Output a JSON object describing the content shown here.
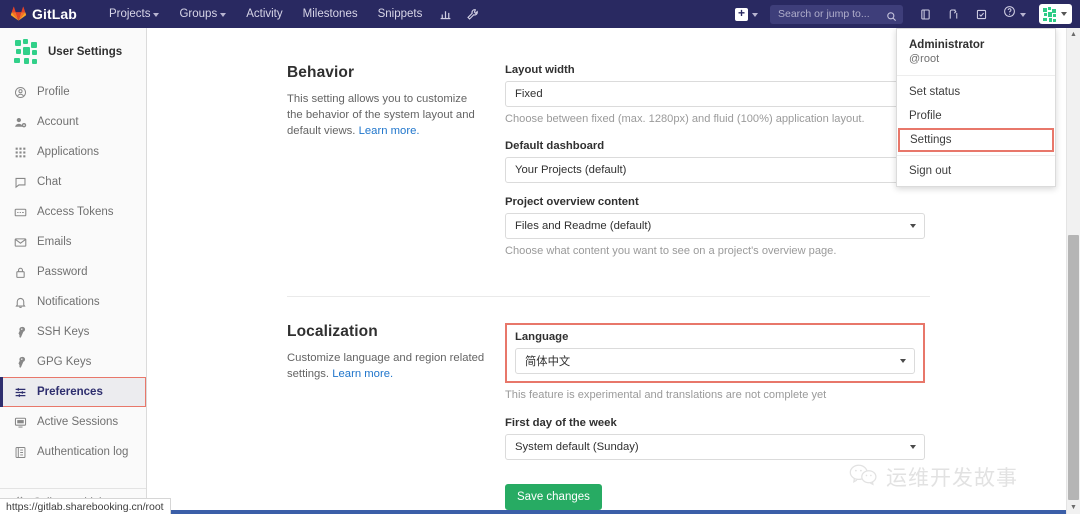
{
  "navbar": {
    "brand": "GitLab",
    "brand_icon": "gitlab-fox-logo",
    "links": [
      {
        "label": "Projects",
        "has_caret": true,
        "name": "nav-projects"
      },
      {
        "label": "Groups",
        "has_caret": true,
        "name": "nav-groups"
      },
      {
        "label": "Activity",
        "has_caret": false,
        "name": "nav-activity"
      },
      {
        "label": "Milestones",
        "has_caret": false,
        "name": "nav-milestones"
      },
      {
        "label": "Snippets",
        "has_caret": false,
        "name": "nav-snippets"
      }
    ],
    "icon_buttons": [
      {
        "name": "analytics-chart-icon"
      },
      {
        "name": "wrench-icon"
      }
    ],
    "plus_label": "+",
    "search": {
      "placeholder": "Search or jump to...",
      "value": "",
      "icon": "search-icon"
    },
    "right_icons": [
      {
        "name": "issues-icon"
      },
      {
        "name": "merge-requests-icon"
      },
      {
        "name": "todos-icon"
      }
    ],
    "help_icon": "help-question-icon",
    "avatar_icon": "user-identicon-avatar"
  },
  "user_dropdown": {
    "name": "Administrator",
    "handle": "@root",
    "items": [
      {
        "label": "Set status",
        "highlighted": false,
        "name": "dropdown-set-status"
      },
      {
        "label": "Profile",
        "highlighted": false,
        "name": "dropdown-profile"
      },
      {
        "label": "Settings",
        "highlighted": true,
        "name": "dropdown-settings"
      },
      {
        "label": "Sign out",
        "highlighted": false,
        "name": "dropdown-sign-out"
      }
    ]
  },
  "sidebar": {
    "title": "User Settings",
    "avatar_icon": "user-identicon-avatar",
    "items": [
      {
        "label": "Profile",
        "icon": "user-circle-icon",
        "active": false,
        "outlined": false
      },
      {
        "label": "Account",
        "icon": "account-gear-icon",
        "active": false,
        "outlined": false
      },
      {
        "label": "Applications",
        "icon": "grid-apps-icon",
        "active": false,
        "outlined": false
      },
      {
        "label": "Chat",
        "icon": "chat-bubble-icon",
        "active": false,
        "outlined": false
      },
      {
        "label": "Access Tokens",
        "icon": "token-card-icon",
        "active": false,
        "outlined": false
      },
      {
        "label": "Emails",
        "icon": "envelope-icon",
        "active": false,
        "outlined": false
      },
      {
        "label": "Password",
        "icon": "lock-icon",
        "active": false,
        "outlined": false
      },
      {
        "label": "Notifications",
        "icon": "bell-icon",
        "active": false,
        "outlined": false
      },
      {
        "label": "SSH Keys",
        "icon": "key-icon",
        "active": false,
        "outlined": false
      },
      {
        "label": "GPG Keys",
        "icon": "key-icon",
        "active": false,
        "outlined": false
      },
      {
        "label": "Preferences",
        "icon": "sliders-icon",
        "active": true,
        "outlined": true
      },
      {
        "label": "Active Sessions",
        "icon": "monitor-icon",
        "active": false,
        "outlined": false
      },
      {
        "label": "Authentication log",
        "icon": "log-book-icon",
        "active": false,
        "outlined": false
      }
    ],
    "collapse_label": "Collapse sidebar",
    "collapse_icon": "double-chevron-left-icon"
  },
  "main": {
    "behavior": {
      "title": "Behavior",
      "description": "This setting allows you to customize the behavior of the system layout and default views.",
      "learn_more": "Learn more.",
      "fields": [
        {
          "label": "Layout width",
          "value": "Fixed",
          "help": "Choose between fixed (max. 1280px) and fluid (100%) application layout.",
          "name": "layout-width-select"
        },
        {
          "label": "Default dashboard",
          "value": "Your Projects (default)",
          "help": "",
          "name": "default-dashboard-select"
        },
        {
          "label": "Project overview content",
          "value": "Files and Readme (default)",
          "help": "Choose what content you want to see on a project's overview page.",
          "name": "project-overview-content-select"
        }
      ]
    },
    "localization": {
      "title": "Localization",
      "description": "Customize language and region related settings.",
      "learn_more": "Learn more.",
      "fields": [
        {
          "label": "Language",
          "value": "简体中文",
          "help": "This feature is experimental and translations are not complete yet",
          "highlighted": true,
          "name": "language-select"
        },
        {
          "label": "First day of the week",
          "value": "System default (Sunday)",
          "help": "",
          "highlighted": false,
          "name": "first-day-of-week-select"
        }
      ],
      "save_label": "Save changes"
    }
  },
  "status_bar": {
    "url": "https://gitlab.sharebooking.cn/root"
  },
  "watermark": {
    "text": "运维开发故事",
    "icon": "wechat-icon"
  },
  "colors": {
    "navbar_bg": "#292961",
    "accent_green": "#27ab63",
    "highlight_red": "#e8776a",
    "link_blue": "#1f75cb"
  }
}
